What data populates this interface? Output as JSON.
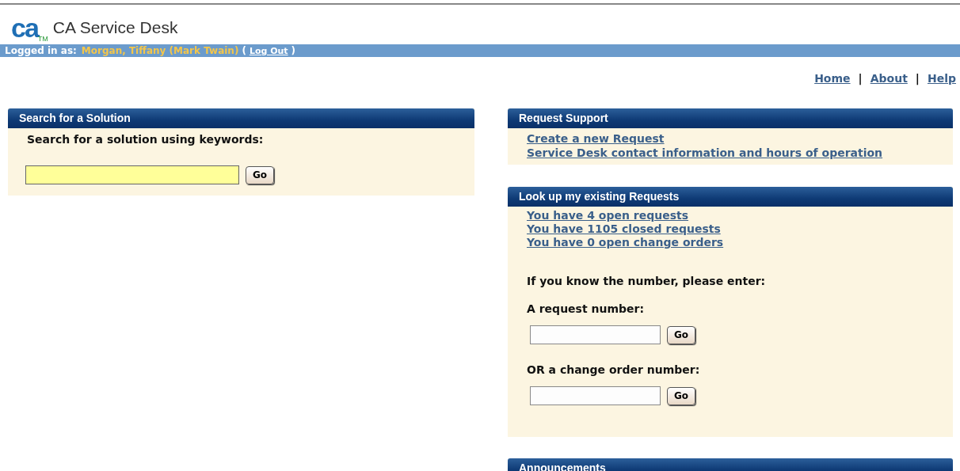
{
  "header": {
    "logo": "ca",
    "logo_mark": "TM",
    "title": "CA Service Desk"
  },
  "login_bar": {
    "label": "Logged in as:",
    "user": "Morgan, Tiffany (Mark Twain)",
    "open_paren": "(",
    "logout": "Log Out",
    "close_paren": ")"
  },
  "nav": [
    {
      "kind": "link",
      "text": "Home"
    },
    {
      "kind": "separator",
      "text": "|"
    },
    {
      "kind": "link",
      "text": "About"
    },
    {
      "kind": "separator",
      "text": "|"
    },
    {
      "kind": "link",
      "text": "Help"
    }
  ],
  "search_panel": {
    "title": "Search for a Solution",
    "prompt": "Search for a solution using keywords:",
    "button": "Go"
  },
  "request_support": {
    "title": "Request Support",
    "links": [
      "Create a new Request",
      "Service Desk contact information and hours of operation"
    ]
  },
  "lookup": {
    "title": "Look up my existing Requests",
    "links": [
      "You have 4 open requests",
      "You have 1105 closed requests",
      "You have 0 open change orders"
    ],
    "intro": "If you know the number, please enter:",
    "fields": [
      {
        "label": "A request number:",
        "button": "Go"
      },
      {
        "label": "OR a change order number:",
        "button": "Go"
      }
    ]
  },
  "announcements": {
    "title": "Announcements"
  }
}
